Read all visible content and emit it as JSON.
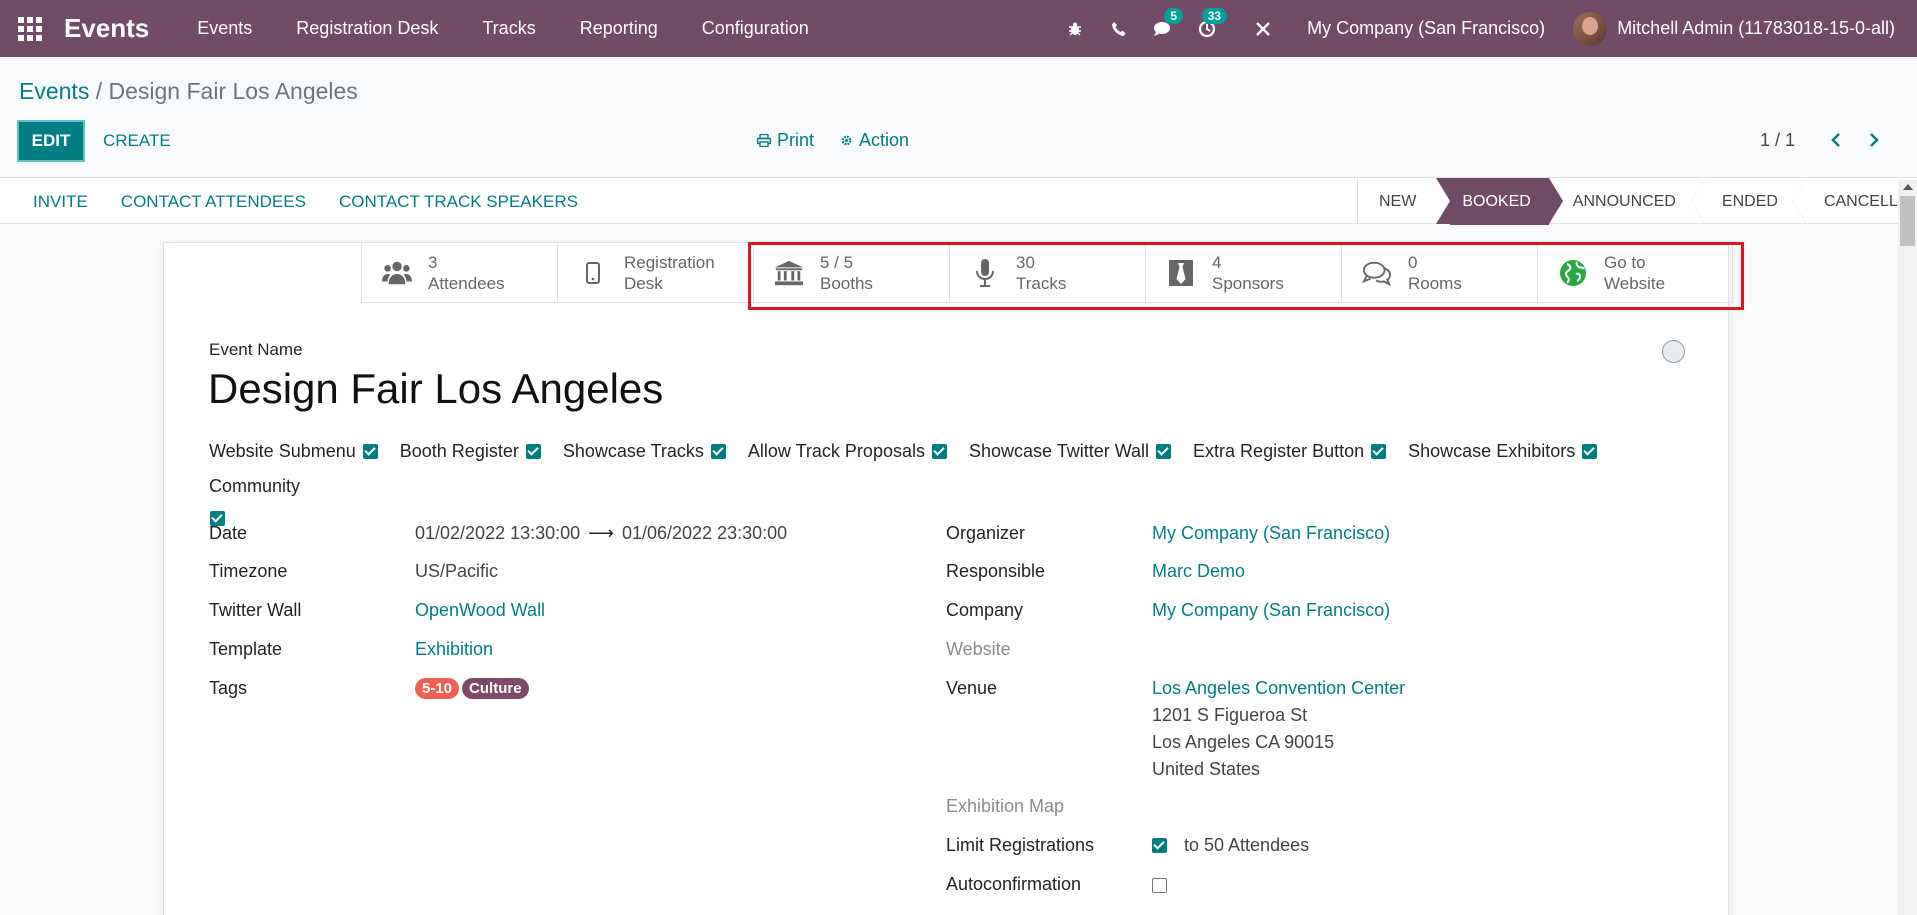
{
  "navbar": {
    "brand": "Events",
    "menu": [
      "Events",
      "Registration Desk",
      "Tracks",
      "Reporting",
      "Configuration"
    ],
    "messages_badge": "5",
    "activities_badge": "33",
    "company": "My Company (San Francisco)",
    "user": "Mitchell Admin (11783018-15-0-all)"
  },
  "breadcrumb": {
    "parent": "Events",
    "separator": " / ",
    "current": "Design Fair Los Angeles"
  },
  "actions": {
    "edit": "EDIT",
    "create": "CREATE",
    "print": "Print",
    "action": "Action"
  },
  "pager": {
    "text": "1 / 1"
  },
  "status_buttons": [
    "INVITE",
    "CONTACT ATTENDEES",
    "CONTACT TRACK SPEAKERS"
  ],
  "stages": [
    "NEW",
    "BOOKED",
    "ANNOUNCED",
    "ENDED",
    "CANCELLED"
  ],
  "active_stage": "BOOKED",
  "smart_buttons": [
    {
      "line1": "3",
      "line2": "Attendees",
      "icon": "users-icon"
    },
    {
      "line1": "Registration",
      "line2": "Desk",
      "icon": "mobile-icon"
    },
    {
      "line1": "5 / 5",
      "line2": "Booths",
      "icon": "bank-icon"
    },
    {
      "line1": "30",
      "line2": "Tracks",
      "icon": "microphone-icon"
    },
    {
      "line1": "4",
      "line2": "Sponsors",
      "icon": "tie-icon"
    },
    {
      "line1": "0",
      "line2": "Rooms",
      "icon": "chat-icon"
    },
    {
      "line1": "Go to",
      "line2": "Website",
      "icon": "globe-icon"
    }
  ],
  "event": {
    "name_label": "Event Name",
    "name": "Design Fair Los Angeles"
  },
  "flags": [
    "Website Submenu",
    "Booth Register",
    "Showcase Tracks",
    "Allow Track Proposals",
    "Showcase Twitter Wall",
    "Extra Register Button",
    "Showcase Exhibitors",
    "Community"
  ],
  "left_fields": {
    "date_label": "Date",
    "date_start": "01/02/2022 13:30:00",
    "date_end": "01/06/2022 23:30:00",
    "timezone_label": "Timezone",
    "timezone": "US/Pacific",
    "twitter_label": "Twitter Wall",
    "twitter": "OpenWood Wall",
    "template_label": "Template",
    "template": "Exhibition",
    "tags_label": "Tags",
    "tags": [
      "5-10",
      "Culture"
    ]
  },
  "right_fields": {
    "organizer_label": "Organizer",
    "organizer": "My Company (San Francisco)",
    "responsible_label": "Responsible",
    "responsible": "Marc Demo",
    "company_label": "Company",
    "company": "My Company (San Francisco)",
    "website_label": "Website",
    "venue_label": "Venue",
    "venue": "Los Angeles Convention Center",
    "venue_street": "1201 S Figueroa St",
    "venue_city": "Los Angeles CA 90015",
    "venue_country": "United States",
    "map_label": "Exhibition Map",
    "limit_label": "Limit Registrations",
    "limit_value": "to 50 Attendees",
    "autoconfirm_label": "Autoconfirmation"
  },
  "colors": {
    "brand": "#714b67",
    "accent": "#017e84",
    "highlight": "#e0141e"
  }
}
